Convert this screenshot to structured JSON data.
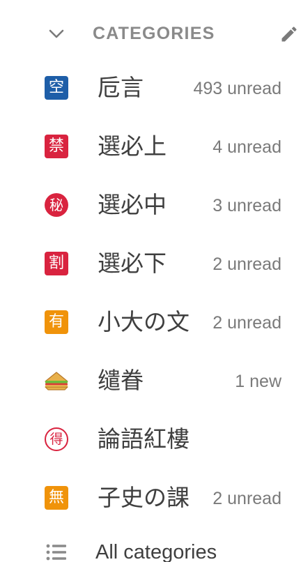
{
  "header": {
    "title": "CATEGORIES",
    "chevron_icon": "chevron-down-icon",
    "edit_icon": "pencil-icon"
  },
  "categories": [
    {
      "glyph": "空",
      "label": "卮言",
      "count": "493 unread",
      "icon_color": "#1e5ea8",
      "icon_style": "square"
    },
    {
      "glyph": "禁",
      "label": "選必上",
      "count": "4 unread",
      "icon_color": "#d9233f",
      "icon_style": "square"
    },
    {
      "glyph": "秘",
      "label": "選必中",
      "count": "3 unread",
      "icon_color": "#d9233f",
      "icon_style": "circle"
    },
    {
      "glyph": "割",
      "label": "選必下",
      "count": "2 unread",
      "icon_color": "#d9233f",
      "icon_style": "square"
    },
    {
      "glyph": "有",
      "label": "小大の文",
      "count": "2 unread",
      "icon_color": "#f0930a",
      "icon_style": "square"
    },
    {
      "glyph": "sandwich",
      "label": "缱眷",
      "count": "1 new",
      "icon_color": "#e8b04a",
      "icon_style": "emoji"
    },
    {
      "glyph": "得",
      "label": "論語紅樓",
      "count": "",
      "icon_color": "#d9233f",
      "icon_style": "circle-outline"
    },
    {
      "glyph": "無",
      "label": "子史の課",
      "count": "2 unread",
      "icon_color": "#f0930a",
      "icon_style": "square"
    }
  ],
  "all_categories": {
    "label": "All categories",
    "icon": "list-icon"
  }
}
